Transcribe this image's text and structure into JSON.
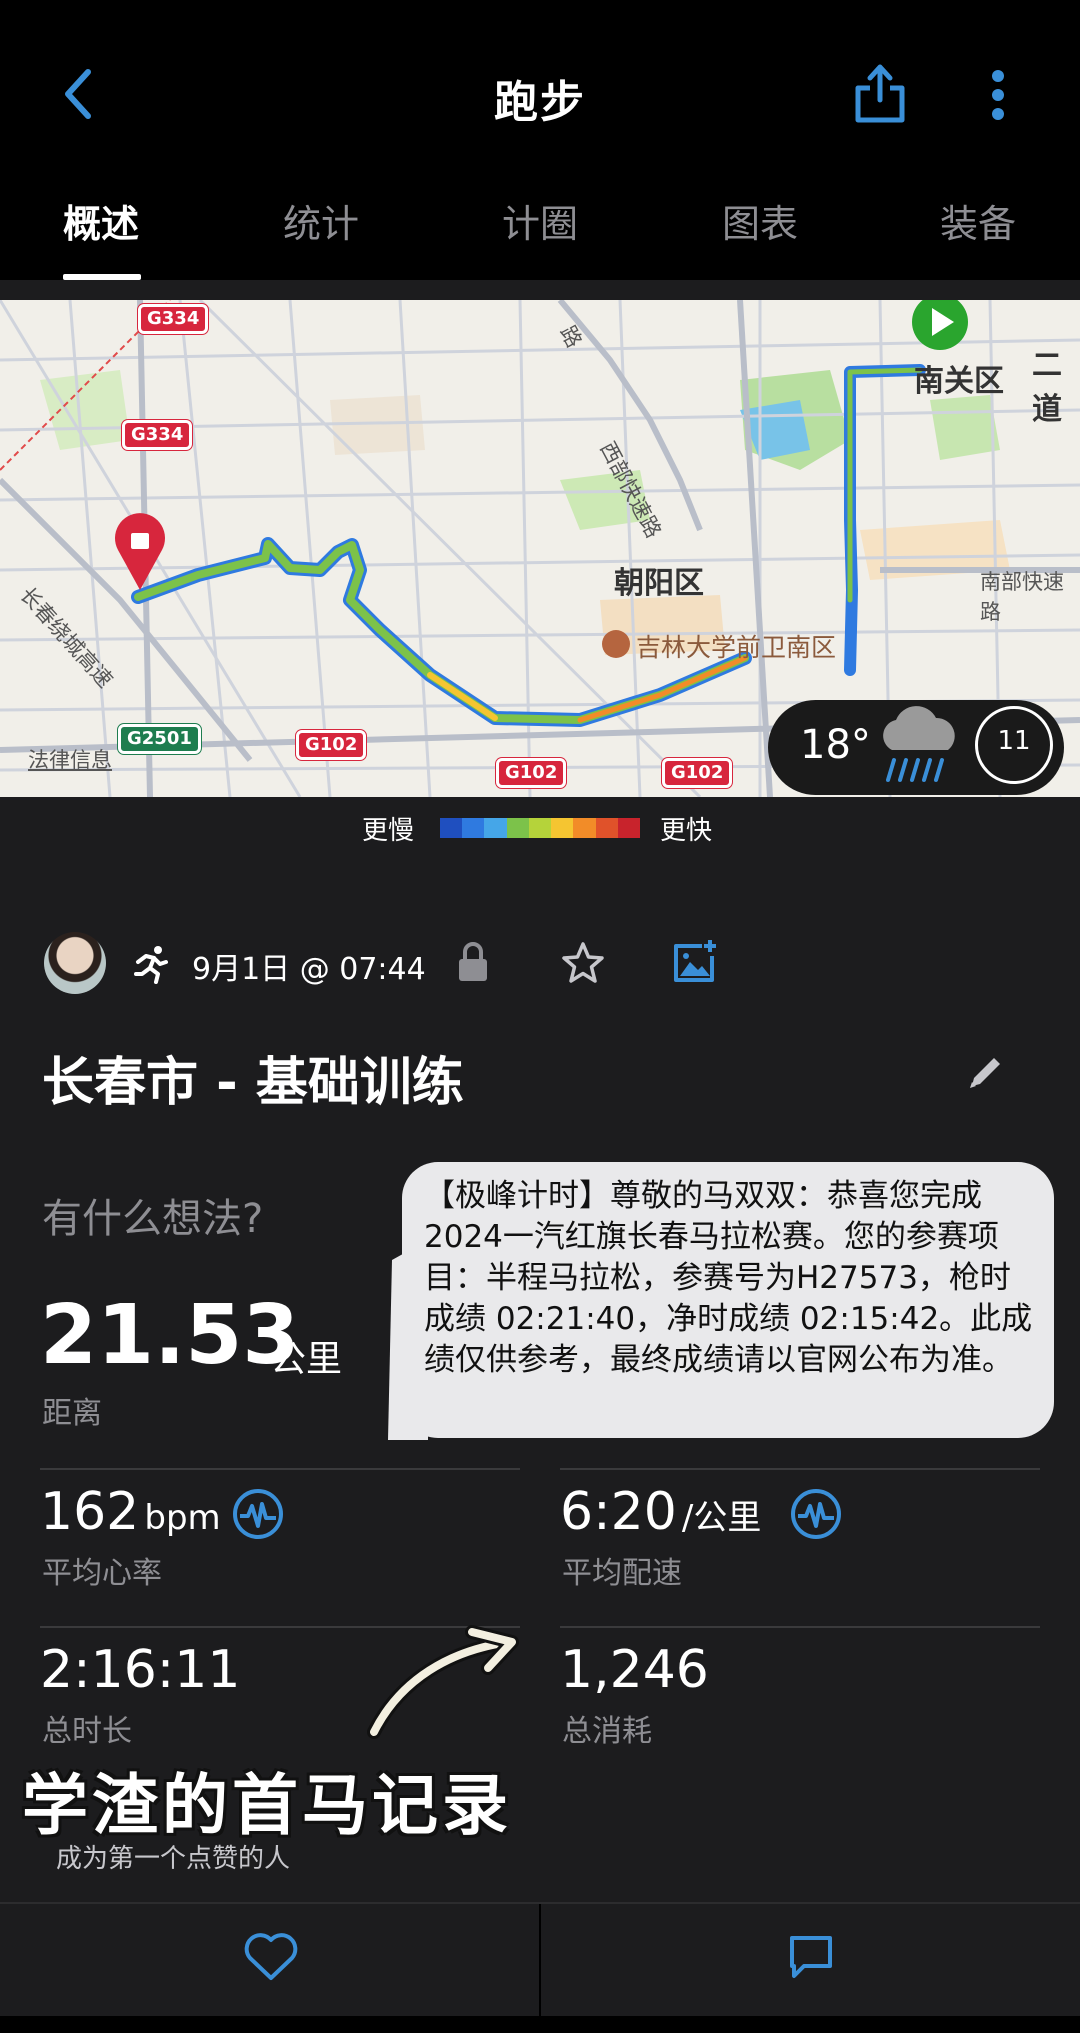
{
  "header": {
    "title": "跑步"
  },
  "tabs": [
    {
      "label": "概述",
      "active": true
    },
    {
      "label": "统计",
      "active": false
    },
    {
      "label": "计圈",
      "active": false
    },
    {
      "label": "图表",
      "active": false
    },
    {
      "label": "装备",
      "active": false
    }
  ],
  "map": {
    "labels": {
      "district": "朝阳区",
      "nanguan": "南关区",
      "erdao": "二道",
      "university": "吉林大学前卫南区",
      "west_expressway": "西部快速路",
      "south_expressway": "南部快速路",
      "ring_expressway": "长春绕城高速",
      "north_road": "路",
      "legal": "法律信息"
    },
    "road_shields": [
      "G334",
      "G334",
      "G2501",
      "G102",
      "G102",
      "G102"
    ],
    "weather": {
      "temperature": "18°",
      "icon": "rain-cloud-icon",
      "wind": "11"
    }
  },
  "legend": {
    "slower": "更慢",
    "faster": "更快",
    "colors": [
      "#1f4fbf",
      "#2f7ae0",
      "#45a6e8",
      "#7cc24a",
      "#b5d33a",
      "#f5c531",
      "#f28c28",
      "#e0522a",
      "#c8232c"
    ]
  },
  "activity": {
    "date": "9月1日 @ 07:44",
    "name": "长春市 - 基础训练",
    "thoughts_placeholder": "有什么想法?",
    "distance": {
      "value": "21.53",
      "unit": "公里",
      "label": "距离"
    },
    "heart_rate": {
      "value": "162",
      "unit": "bpm",
      "label": "平均心率"
    },
    "pace": {
      "value": "6:20",
      "unit": "/公里",
      "label": "平均配速"
    },
    "duration": {
      "value": "2:16:11",
      "label": "总时长"
    },
    "calories": {
      "value": "1,246",
      "label": "总消耗"
    },
    "first_like": "成为第一个点赞的人"
  },
  "sms": {
    "text": "【极峰计时】尊敬的马双双：恭喜您完成 2024一汽红旗长春马拉松赛。您的参赛项目：半程马拉松，参赛号为H27573，枪时成绩 02:21:40，净时成绩 02:15:42。此成绩仅供参考，最终成绩请以官网公布为准。"
  },
  "overlay": {
    "caption": "学渣的首马记录"
  },
  "colors": {
    "accent": "#3a8fd8",
    "background": "#1c1c1e",
    "start": "#2aa52e",
    "end": "#d7263d"
  }
}
